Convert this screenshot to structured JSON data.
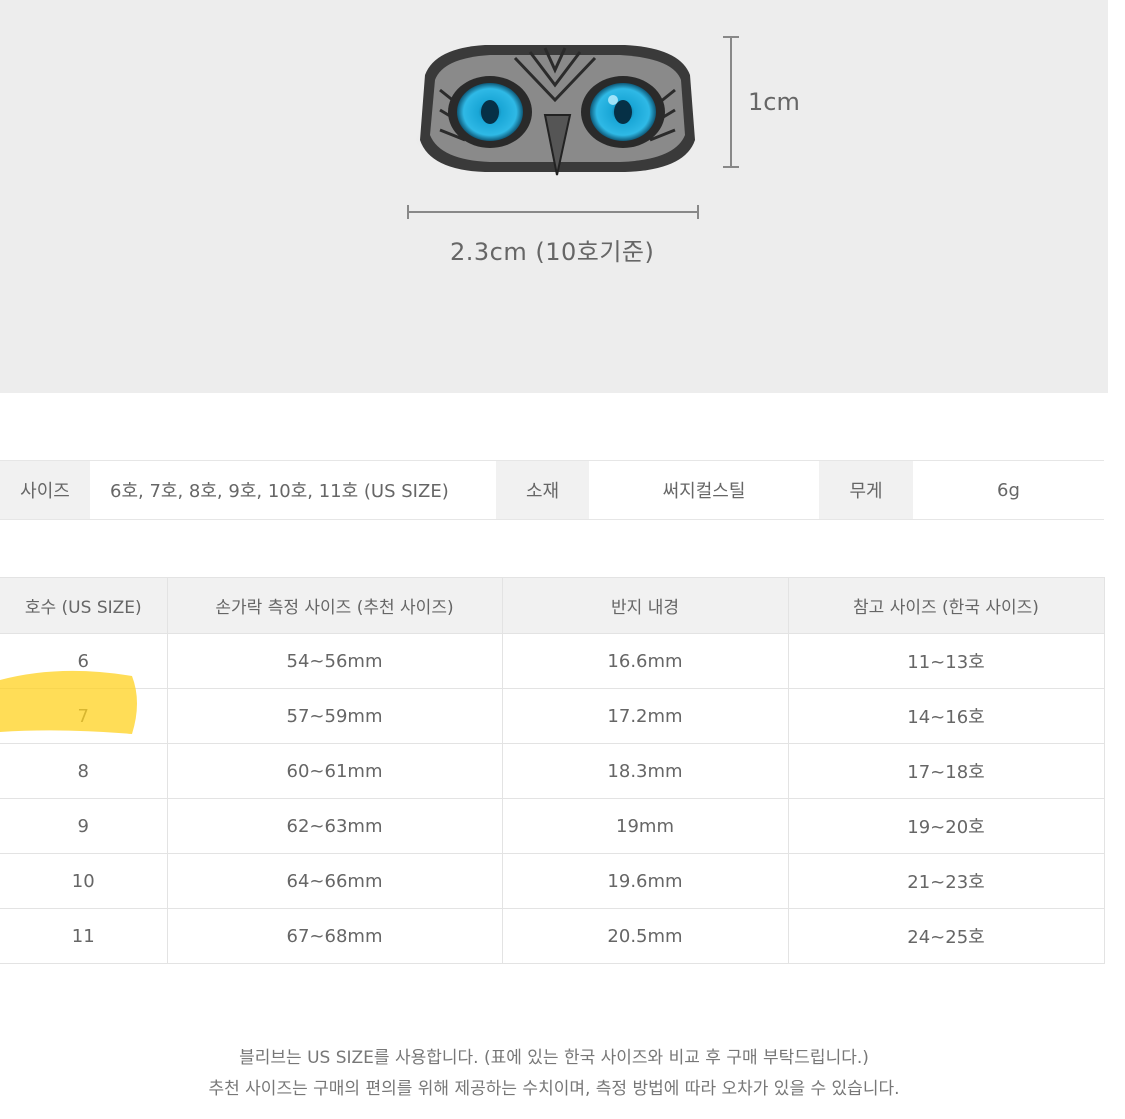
{
  "hero": {
    "height_label": "1cm",
    "width_label": "2.3cm (10호기준)",
    "image_icon": "owl-ring-icon"
  },
  "spec": {
    "size_key": "사이즈",
    "size_value": "6호, 7호, 8호, 9호, 10호, 11호 (US SIZE)",
    "material_key": "소재",
    "material_value": "써지컬스틸",
    "weight_key": "무게",
    "weight_value": "6g"
  },
  "table": {
    "headers": [
      "호수 (US SIZE)",
      "손가락 측정 사이즈 (추천 사이즈)",
      "반지 내경",
      "참고 사이즈 (한국 사이즈)"
    ],
    "rows": [
      [
        "6",
        "54~56mm",
        "16.6mm",
        "11~13호"
      ],
      [
        "7",
        "57~59mm",
        "17.2mm",
        "14~16호"
      ],
      [
        "8",
        "60~61mm",
        "18.3mm",
        "17~18호"
      ],
      [
        "9",
        "62~63mm",
        "19mm",
        "19~20호"
      ],
      [
        "10",
        "64~66mm",
        "19.6mm",
        "21~23호"
      ],
      [
        "11",
        "67~68mm",
        "20.5mm",
        "24~25호"
      ]
    ],
    "highlight_color": "#ffd21f"
  },
  "notes": {
    "line1": "블리브는 US SIZE를 사용합니다. (표에 있는 한국 사이즈와 비교 후 구매 부탁드립니다.)",
    "line2": "추천 사이즈는 구매의 편의를 위해 제공하는 수치이며, 측정 방법에 따라 오차가 있을 수 있습니다."
  }
}
